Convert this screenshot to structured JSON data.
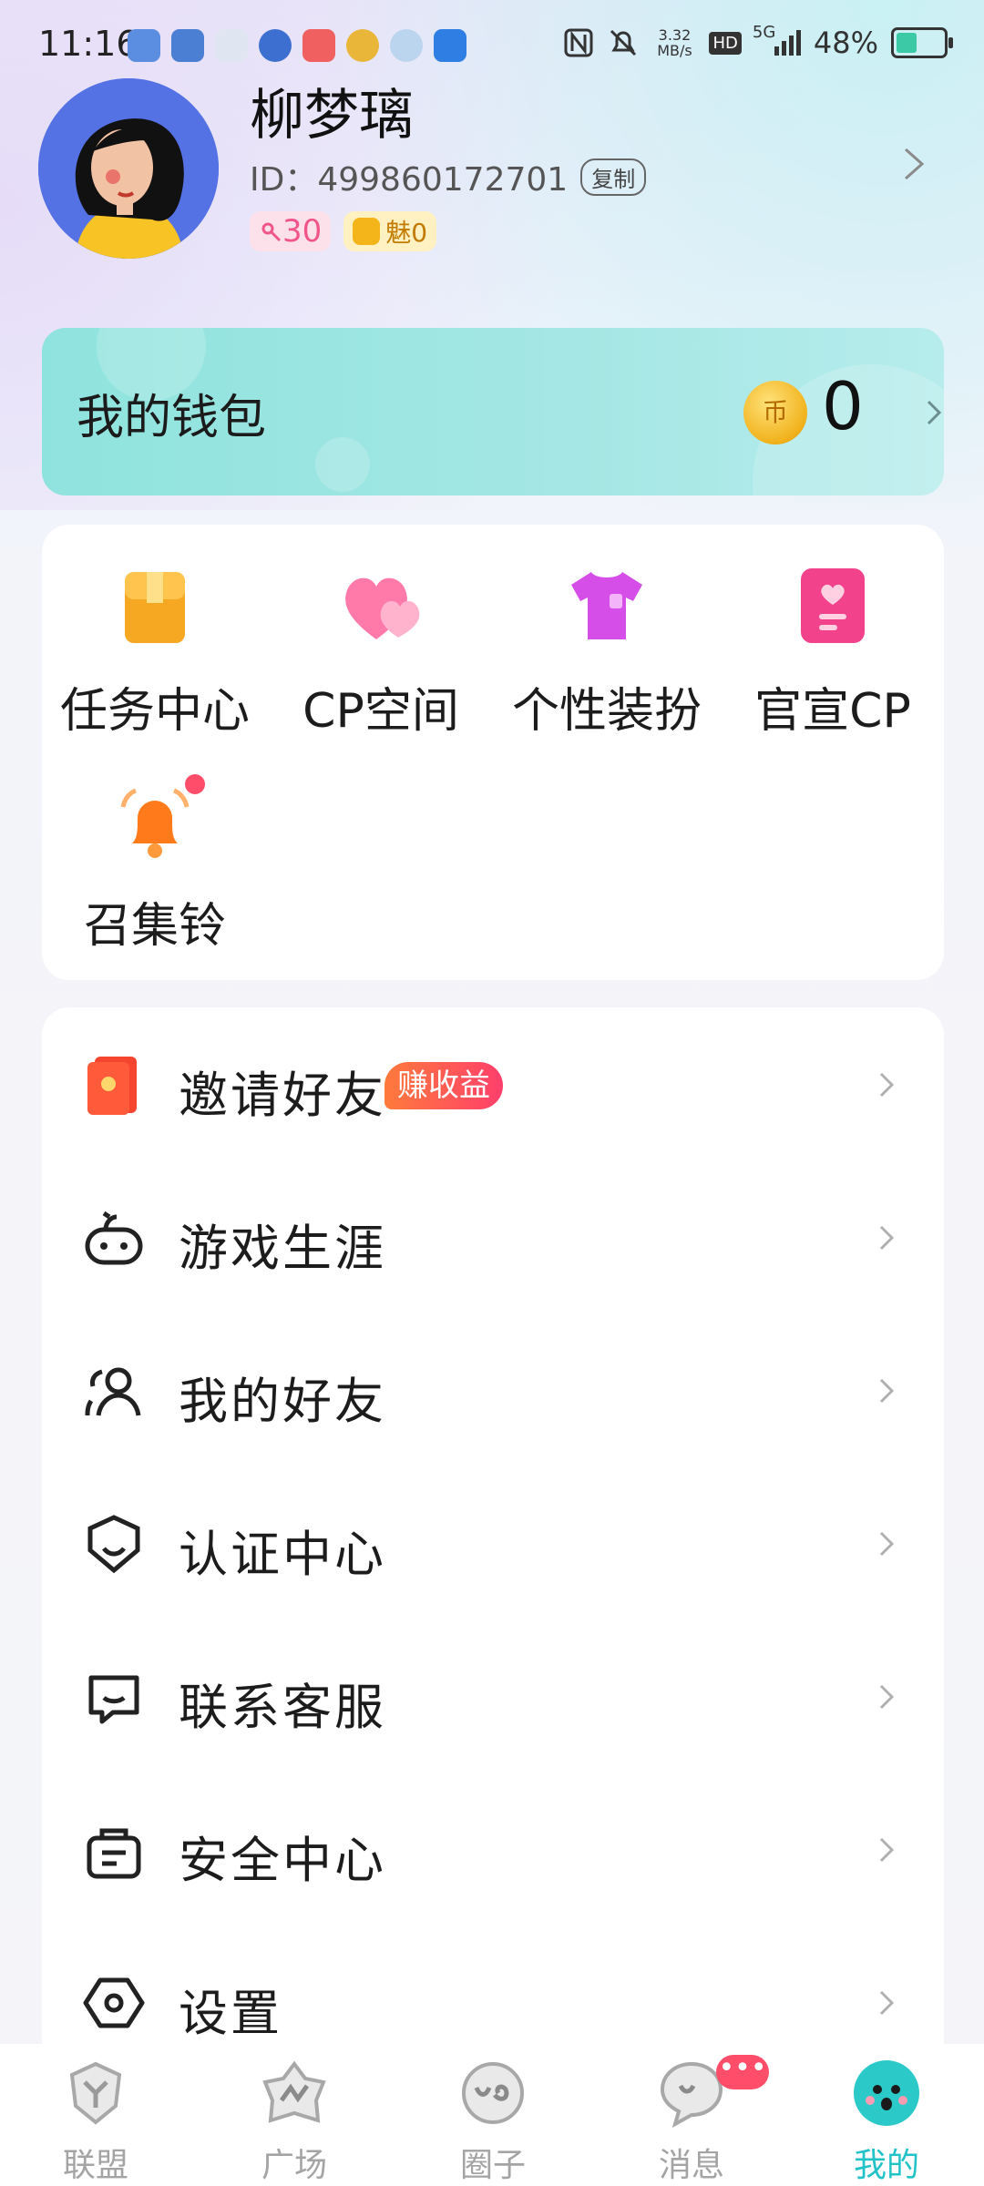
{
  "status_bar": {
    "time": "11:16",
    "network_speed": "3.32 MB/s",
    "hd": "HD",
    "signal": "5G",
    "battery": "48%"
  },
  "profile": {
    "name": "柳梦璃",
    "id_text": "ID：499860172701",
    "copy_label": "复制",
    "level": "30",
    "charm_label": "魅0"
  },
  "wallet": {
    "title": "我的钱包",
    "coin_symbol": "币",
    "balance": "0"
  },
  "features": [
    {
      "label": "任务中心",
      "icon": "task-bag-icon"
    },
    {
      "label": "CP空间",
      "icon": "hearts-icon"
    },
    {
      "label": "个性装扮",
      "icon": "tshirt-icon"
    },
    {
      "label": "官宣CP",
      "icon": "announce-card-icon"
    },
    {
      "label": "召集铃",
      "icon": "bell-icon"
    }
  ],
  "menu": [
    {
      "label": "邀请好友",
      "tag": "赚收益",
      "icon": "red-envelope-icon"
    },
    {
      "label": "游戏生涯",
      "icon": "gamepad-icon"
    },
    {
      "label": "我的好友",
      "icon": "friends-icon"
    },
    {
      "label": "认证中心",
      "icon": "shield-check-icon"
    },
    {
      "label": "联系客服",
      "icon": "chat-support-icon"
    },
    {
      "label": "安全中心",
      "icon": "safe-box-icon"
    },
    {
      "label": "设置",
      "icon": "settings-icon"
    }
  ],
  "nav": [
    {
      "label": "联盟",
      "icon": "alliance-icon"
    },
    {
      "label": "广场",
      "icon": "plaza-icon"
    },
    {
      "label": "圈子",
      "icon": "circle-icon"
    },
    {
      "label": "消息",
      "icon": "message-icon",
      "badge": "•••"
    },
    {
      "label": "我的",
      "icon": "mine-icon",
      "active": true
    }
  ],
  "colors": {
    "accent": "#22c3c8",
    "wallet_bg": "#a5e7e4",
    "earn_tag": "#ff4f5e",
    "badge_red": "#ff4d6a"
  }
}
